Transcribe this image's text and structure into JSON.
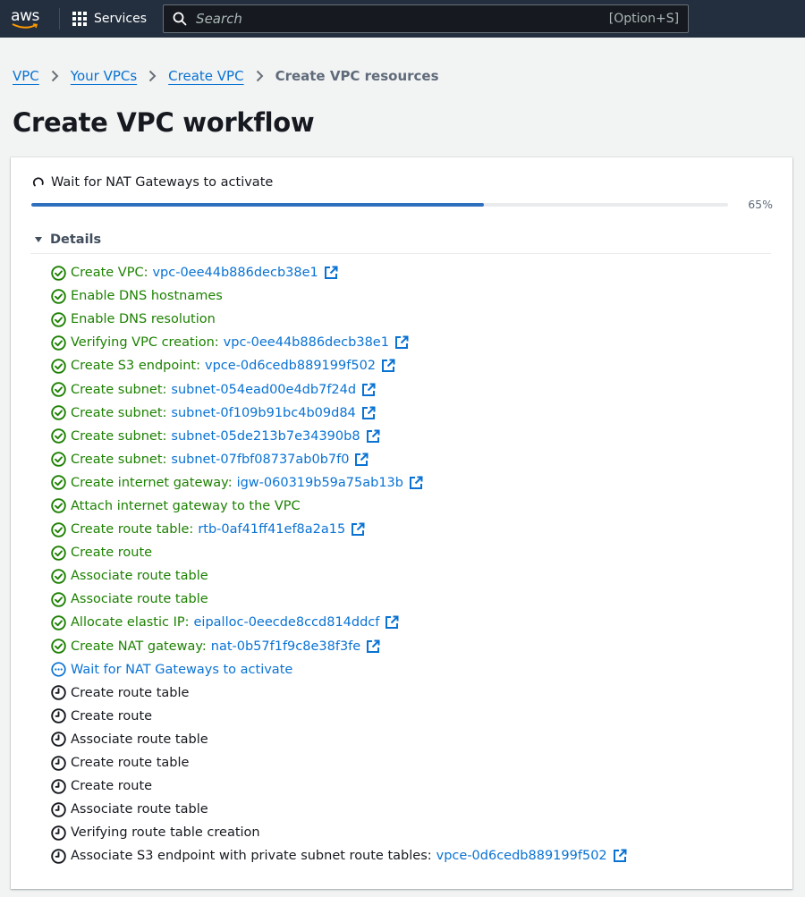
{
  "topnav": {
    "logo_text": "aws",
    "services_label": "Services",
    "search_placeholder": "Search",
    "search_shortcut": "[Option+S]"
  },
  "breadcrumb": [
    {
      "label": "VPC",
      "link": true
    },
    {
      "label": "Your VPCs",
      "link": true
    },
    {
      "label": "Create VPC",
      "link": true
    },
    {
      "label": "Create VPC resources",
      "link": false
    }
  ],
  "page_title": "Create VPC workflow",
  "workflow": {
    "current_status": "Wait for NAT Gateways to activate",
    "progress_percent": 65,
    "progress_label": "65%",
    "details_label": "Details",
    "details_expanded": true,
    "steps": [
      {
        "label": "Create VPC:",
        "resource": "vpc-0ee44b886decb38e1",
        "status": "success"
      },
      {
        "label": "Enable DNS hostnames",
        "resource": null,
        "status": "success"
      },
      {
        "label": "Enable DNS resolution",
        "resource": null,
        "status": "success"
      },
      {
        "label": "Verifying VPC creation:",
        "resource": "vpc-0ee44b886decb38e1",
        "status": "success"
      },
      {
        "label": "Create S3 endpoint:",
        "resource": "vpce-0d6cedb889199f502",
        "status": "success"
      },
      {
        "label": "Create subnet:",
        "resource": "subnet-054ead00e4db7f24d",
        "status": "success"
      },
      {
        "label": "Create subnet:",
        "resource": "subnet-0f109b91bc4b09d84",
        "status": "success"
      },
      {
        "label": "Create subnet:",
        "resource": "subnet-05de213b7e34390b8",
        "status": "success"
      },
      {
        "label": "Create subnet:",
        "resource": "subnet-07fbf08737ab0b7f0",
        "status": "success"
      },
      {
        "label": "Create internet gateway:",
        "resource": "igw-060319b59a75ab13b",
        "status": "success"
      },
      {
        "label": "Attach internet gateway to the VPC",
        "resource": null,
        "status": "success"
      },
      {
        "label": "Create route table:",
        "resource": "rtb-0af41ff41ef8a2a15",
        "status": "success"
      },
      {
        "label": "Create route",
        "resource": null,
        "status": "success"
      },
      {
        "label": "Associate route table",
        "resource": null,
        "status": "success"
      },
      {
        "label": "Associate route table",
        "resource": null,
        "status": "success"
      },
      {
        "label": "Allocate elastic IP:",
        "resource": "eipalloc-0eecde8ccd814ddcf",
        "status": "success"
      },
      {
        "label": "Create NAT gateway:",
        "resource": "nat-0b57f1f9c8e38f3fe",
        "status": "success"
      },
      {
        "label": "Wait for NAT Gateways to activate",
        "resource": null,
        "status": "in-progress"
      },
      {
        "label": "Create route table",
        "resource": null,
        "status": "pending"
      },
      {
        "label": "Create route",
        "resource": null,
        "status": "pending"
      },
      {
        "label": "Associate route table",
        "resource": null,
        "status": "pending"
      },
      {
        "label": "Create route table",
        "resource": null,
        "status": "pending"
      },
      {
        "label": "Create route",
        "resource": null,
        "status": "pending"
      },
      {
        "label": "Associate route table",
        "resource": null,
        "status": "pending"
      },
      {
        "label": "Verifying route table creation",
        "resource": null,
        "status": "pending"
      },
      {
        "label": "Associate S3 endpoint with private subnet route tables:",
        "resource": "vpce-0d6cedb889199f502",
        "status": "pending"
      }
    ]
  },
  "colors": {
    "nav_bg": "#232f3e",
    "link": "#0972d3",
    "success": "#1d8102",
    "progress": "#2e6fbe",
    "logo_smile": "#ff9900"
  }
}
